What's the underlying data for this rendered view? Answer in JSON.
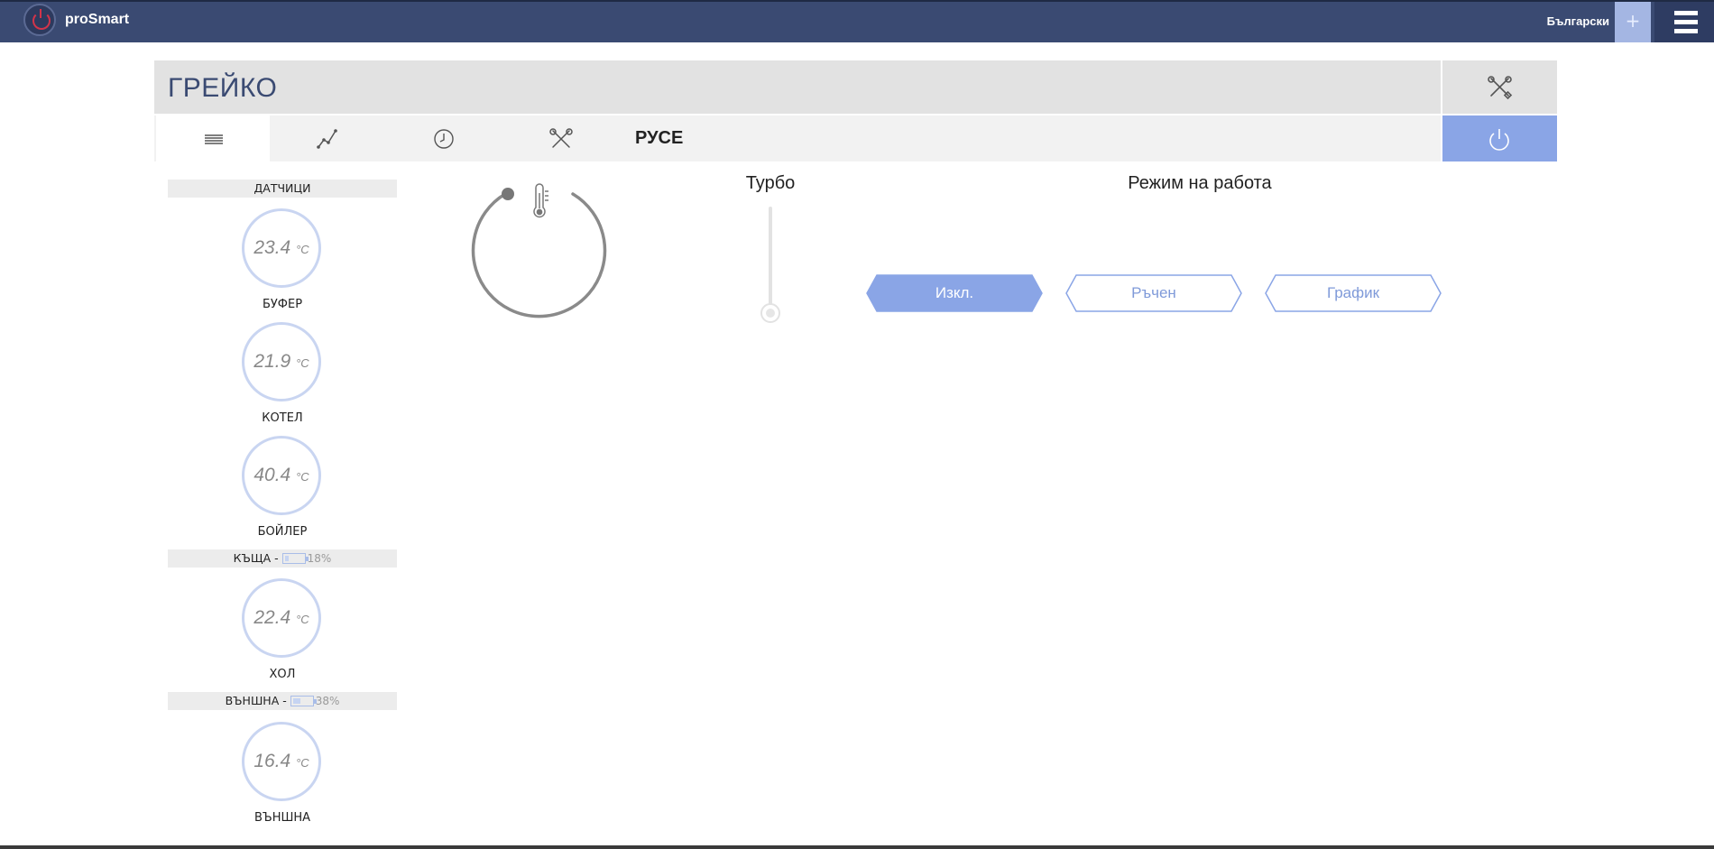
{
  "topbar": {
    "brand": "proSmart",
    "language": "Български",
    "plus_icon": "plus-icon",
    "menu_icon": "hamburger-icon"
  },
  "header": {
    "title": "ГРЕЙКО",
    "tools_icon": "tools-icon"
  },
  "tabs": {
    "items": [
      {
        "icon": "list-icon"
      },
      {
        "icon": "chart-line-icon"
      },
      {
        "icon": "clock-icon"
      },
      {
        "icon": "tools-icon"
      }
    ],
    "city": "РУСЕ",
    "power_icon": "power-icon"
  },
  "sidebar": {
    "sensors_title": "ДАТЧИЦИ",
    "sensors": [
      {
        "value": "23.4",
        "unit": "°C",
        "name": "БУФЕР"
      },
      {
        "value": "21.9",
        "unit": "°C",
        "name": "КОТЕЛ"
      },
      {
        "value": "40.4",
        "unit": "°C",
        "name": "БОЙЛЕР"
      }
    ],
    "house": {
      "title": "КЪЩА -",
      "battery_pct": "18%",
      "battery_level": 0.18,
      "sensor": {
        "value": "22.4",
        "unit": "°C",
        "name": "ХОЛ"
      }
    },
    "outside": {
      "title": "ВЪНШНА -",
      "battery_pct": "38%",
      "battery_level": 0.38,
      "sensor": {
        "value": "16.4",
        "unit": "°C",
        "name": "ВЪНШНА"
      }
    }
  },
  "thermostat": {
    "icon": "thermometer-icon"
  },
  "turbo": {
    "label": "Турбо"
  },
  "mode": {
    "label": "Режим на работа",
    "buttons": [
      {
        "label": "Изкл.",
        "active": true
      },
      {
        "label": "Ръчен",
        "active": false
      },
      {
        "label": "График",
        "active": false
      }
    ]
  },
  "colors": {
    "topbar": "#3a4a72",
    "accent": "#8aa5e6",
    "sensor_ring": "#c9d5f1"
  }
}
